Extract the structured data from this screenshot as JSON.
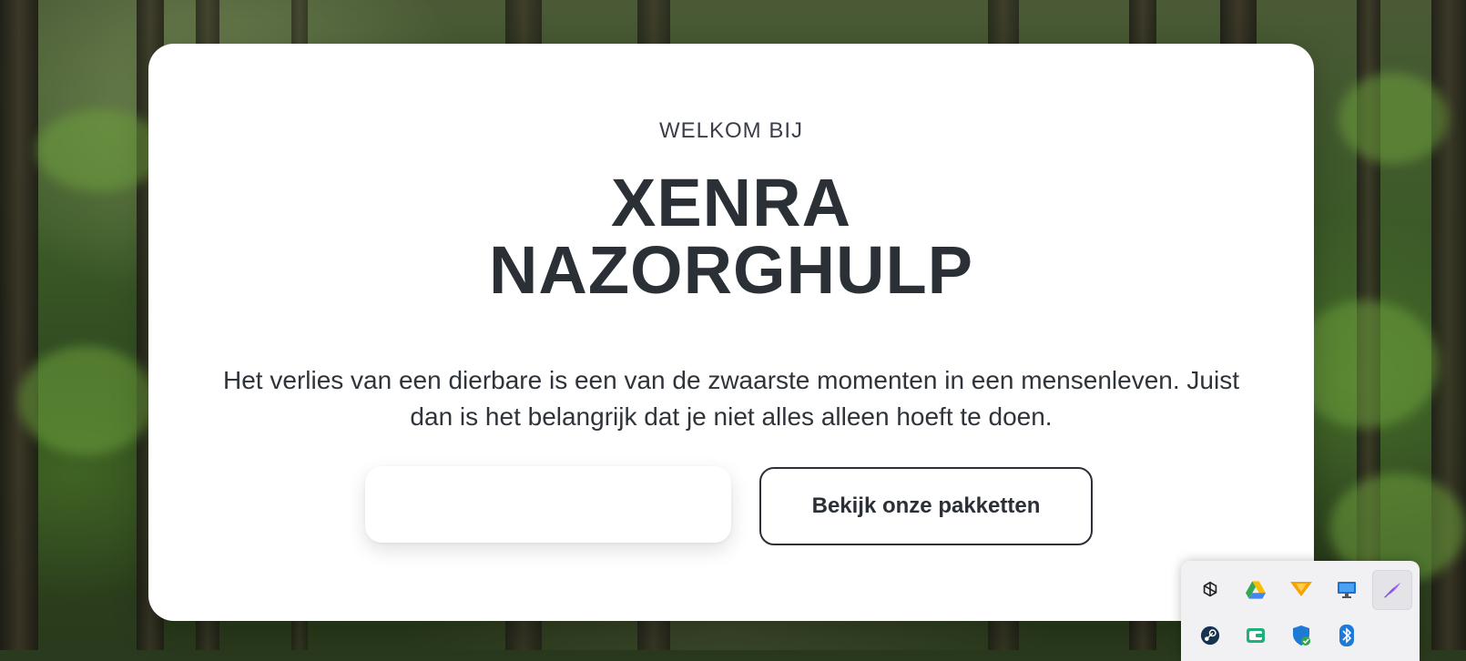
{
  "hero": {
    "eyebrow": "WELKOM BIJ",
    "title_line1": "XENRA",
    "title_line2": "NAZORGHULP",
    "intro": "Het verlies van een dierbare is een van de zwaarste momenten in een mensenleven. Juist dan is het belangrijk dat je niet alles alleen hoeft te doen.",
    "primary_button_label": "",
    "secondary_button_label": "Bekijk onze pakketten"
  },
  "tray": {
    "icons": [
      "chatgpt-icon",
      "google-drive-icon",
      "vpn-icon",
      "monitor-icon",
      "feather-icon",
      "steam-icon",
      "wallet-icon",
      "security-shield-icon",
      "bluetooth-icon"
    ]
  },
  "colors": {
    "text": "#2b3037",
    "card": "#ffffff",
    "tray": "#f1f1f3"
  }
}
